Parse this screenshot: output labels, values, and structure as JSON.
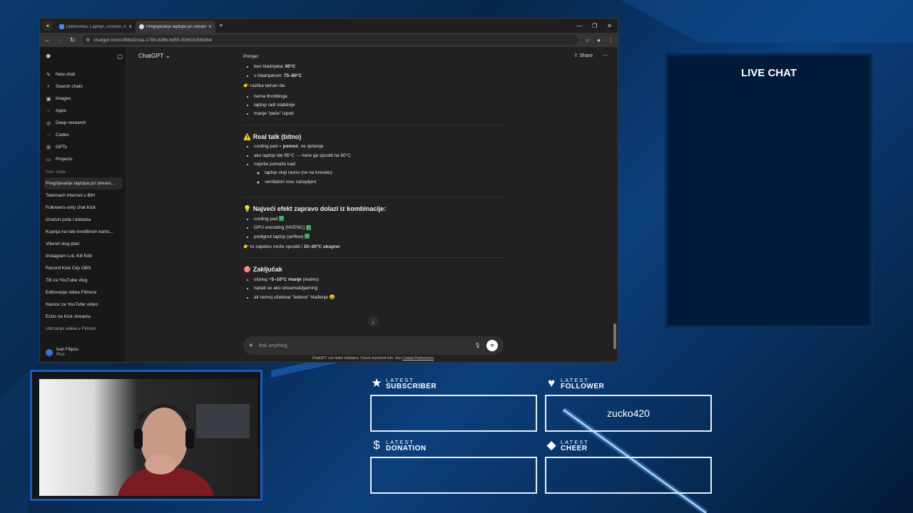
{
  "browser": {
    "tabs": [
      {
        "title": "Elektronika, Laptopi, Dronovi, It"
      },
      {
        "title": "Pregrijavanje laptopa pri stream"
      }
    ],
    "url": "chatgpt.com/c/69bd2cda-1788-838b-bd55-82652c93d3b4"
  },
  "sidebar": {
    "items": [
      {
        "label": "New chat",
        "icon": "pencil-icon"
      },
      {
        "label": "Search chats",
        "icon": "search-icon"
      },
      {
        "label": "Images",
        "icon": "image-icon"
      },
      {
        "label": "Apps",
        "icon": "apps-icon"
      },
      {
        "label": "Deep research",
        "icon": "research-icon"
      },
      {
        "label": "Codex",
        "icon": "codex-icon"
      },
      {
        "label": "GPTs",
        "icon": "gpts-icon"
      },
      {
        "label": "Projects",
        "icon": "folder-icon"
      }
    ],
    "section_label": "Your chats",
    "chats": [
      "Pregrijavanje laptopa pri stream...",
      "Telemach internet u BiH",
      "Followers-only chat Kick",
      "Izračun puta i dolaska",
      "Kupnja na rate kreditnom kartic...",
      "Vikend vlog plan",
      "Instagram LoL Kill Edit",
      "Record Kick Clip OBS",
      "Titl za YouTube vlog",
      "Editovanje videa Filmora",
      "Naslov za YouTube video",
      "Echo na Kick streamu",
      "Ubrzanje videa u Filmori"
    ],
    "user": {
      "name": "Ivan Filipcic",
      "plan": "Plus"
    }
  },
  "header": {
    "model": "ChatGPT",
    "share": "Share"
  },
  "content": {
    "primjer": "Primjer:",
    "primjer_items": [
      {
        "label": "bez hladnjaka: ",
        "value": "85°C"
      },
      {
        "label": "s hladnjakom: ",
        "value": "75–80°C"
      }
    ],
    "razlika": "👉 razlika taman da:",
    "razlika_items": [
      "nema throttlinga",
      "laptop radi stabilnije",
      "manje \"peče\" ispod"
    ],
    "s1_title": "⚠️ Real talk (bitno)",
    "s1_item1_a": "cooling pad = ",
    "s1_item1_b": "pomoć",
    "s1_item1_c": ", ne rješenje",
    "s1_item2": "ako laptop ide 95°C → neće ga spustit na 60°C",
    "s1_item3": "najviše pomaže kad:",
    "s1_sub": [
      "laptop stoji ravno (ne na krevetu)",
      "ventilatori nisu začepljeni"
    ],
    "s2_title": "💡 Najveći efekt zapravo dolazi iz kombinacije:",
    "s2_items": [
      "cooling pad",
      "GPU encoding (NVENC)",
      "podignut laptop (airflow)"
    ],
    "s2_check": "✓",
    "s2_note_a": "👉 to zajedno može spustiti i ",
    "s2_note_b": "10–20°C ukupno",
    "s3_title": "🎯 Zaključak",
    "s3_item1_a": "očekuj ",
    "s3_item1_b": "~5–10°C manje",
    "s3_item1_c": " (realno)",
    "s3_item2": "isplati se ako streamaš/gaming",
    "s3_item3": "ali nemoj očekivat \"ledeno\" hlađenje 😅"
  },
  "composer": {
    "placeholder": "Ask anything",
    "disclaimer_a": "ChatGPT can make mistakes. Check important info. See ",
    "disclaimer_link": "Cookie Preferences",
    "disclaimer_b": "."
  },
  "overlay": {
    "livechat_title": "LIVE CHAT",
    "widgets": [
      {
        "small": "LATEST",
        "big": "SUBSCRIBER",
        "value": "",
        "icon": "star-icon"
      },
      {
        "small": "LATEST",
        "big": "FOLLOWER",
        "value": "zucko420",
        "icon": "heart-icon"
      },
      {
        "small": "LATEST",
        "big": "DONATION",
        "value": "",
        "icon": "dollar-icon"
      },
      {
        "small": "LATEST",
        "big": "CHEER",
        "value": "",
        "icon": "diamond-icon"
      }
    ]
  }
}
